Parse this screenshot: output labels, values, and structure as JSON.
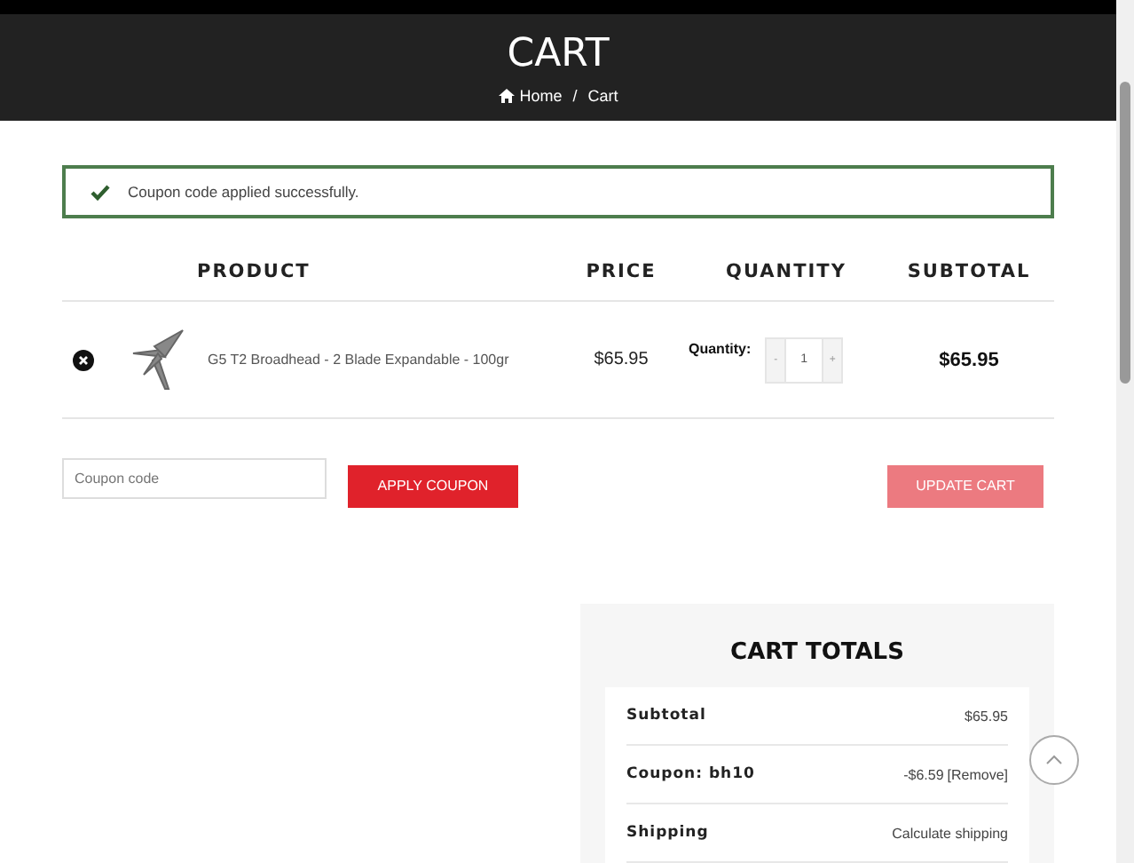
{
  "header": {
    "title": "CART",
    "breadcrumb_separator": "/",
    "breadcrumb": [
      {
        "label": "Home",
        "kind": "home"
      },
      {
        "label": "Cart",
        "kind": "current"
      }
    ]
  },
  "notice": {
    "message": "Coupon code applied successfully."
  },
  "table": {
    "columns": [
      "PRODUCT",
      "PRICE",
      "QUANTITY",
      "SUBTOTAL"
    ],
    "rows": [
      {
        "name": "G5 T2 Broadhead - 2 Blade Expandable - 100gr",
        "price": "$65.95",
        "quantity_label": "Quantity:",
        "minus": "-",
        "quantity": "1",
        "plus": "+",
        "subtotal": "$65.95"
      }
    ]
  },
  "coupon": {
    "placeholder": "Coupon code",
    "apply_button": "APPLY COUPON",
    "update_button": "UPDATE CART",
    "update_disabled": true
  },
  "totals": {
    "title": "CART TOTALS",
    "rows": [
      {
        "label": "Subtotal",
        "value": "$65.95"
      },
      {
        "label": "Coupon: bh10",
        "value": "-$6.59",
        "link": "[Remove]"
      },
      {
        "label": "Shipping",
        "value": "Calculate shipping"
      }
    ]
  }
}
